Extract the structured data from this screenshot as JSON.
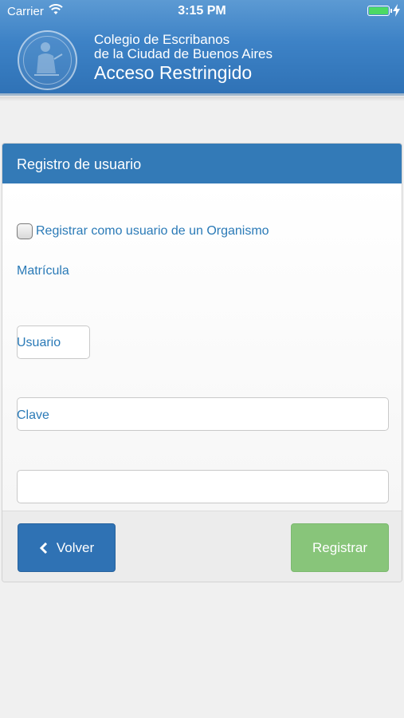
{
  "status_bar": {
    "carrier": "Carrier",
    "time": "3:15 PM",
    "battery_color": "#4cd964"
  },
  "header": {
    "line1": "Colegio de Escribanos",
    "line2": "de la Ciudad de Buenos Aires",
    "title": "Acceso Restringido",
    "background_color": "#3d82c6"
  },
  "panel": {
    "heading": "Registro de usuario",
    "checkbox_label": "Registrar como usuario de un Organismo",
    "checkbox_checked": false,
    "fields": {
      "matricula": {
        "label": "Matrícula",
        "value": ""
      },
      "usuario": {
        "label": "Usuario",
        "value": ""
      },
      "clave": {
        "label": "Clave",
        "value": ""
      }
    }
  },
  "footer": {
    "back_label": "Volver",
    "submit_label": "Registrar",
    "back_color": "#2f72b4",
    "submit_color": "#88c57a"
  },
  "icons": [
    "wifi-icon",
    "battery-icon",
    "charging-bolt-icon",
    "logo-icon",
    "chevron-left-icon"
  ]
}
